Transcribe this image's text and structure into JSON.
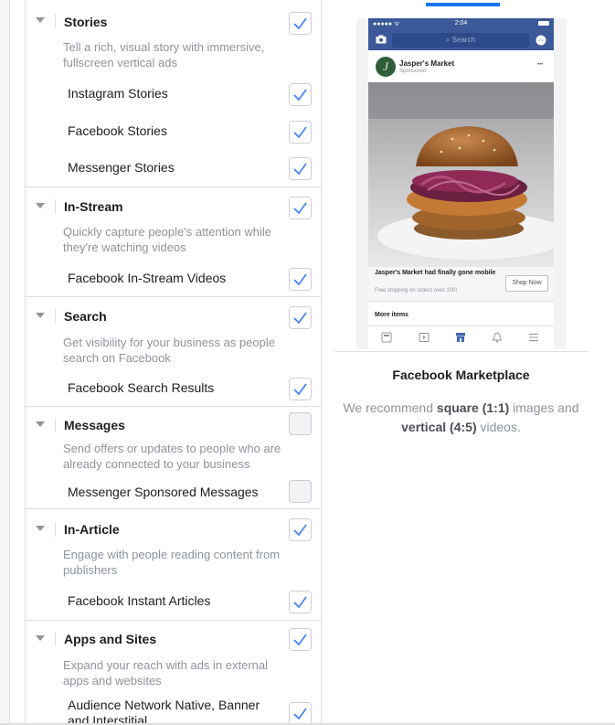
{
  "sections": [
    {
      "title": "Stories",
      "checked": true,
      "description": "Tell a rich, visual story with immersive, fullscreen vertical ads",
      "items": [
        {
          "label": "Instagram Stories",
          "checked": true
        },
        {
          "label": "Facebook Stories",
          "checked": true
        },
        {
          "label": "Messenger Stories",
          "checked": true
        }
      ]
    },
    {
      "title": "In-Stream",
      "checked": true,
      "description": "Quickly capture people's attention while they're watching videos",
      "items": [
        {
          "label": "Facebook In-Stream Videos",
          "checked": true
        }
      ]
    },
    {
      "title": "Search",
      "checked": true,
      "description": "Get visibility for your business as people search on Facebook",
      "items": [
        {
          "label": "Facebook Search Results",
          "checked": true
        }
      ]
    },
    {
      "title": "Messages",
      "checked": false,
      "description": "Send offers or updates to people who are already connected to your business",
      "items": [
        {
          "label": "Messenger Sponsored Messages",
          "checked": false
        }
      ]
    },
    {
      "title": "In-Article",
      "checked": true,
      "description": "Engage with people reading content from publishers",
      "items": [
        {
          "label": "Facebook Instant Articles",
          "checked": true
        }
      ]
    },
    {
      "title": "Apps and Sites",
      "checked": true,
      "description": "Expand your reach with ads in external apps and websites",
      "items": [
        {
          "label": "Audience Network Native, Banner and Interstitial",
          "checked": true
        }
      ]
    }
  ],
  "preview": {
    "status_time": "2:04",
    "status_carrier": "●●●●● ᯤ",
    "search_placeholder": "Search",
    "advertiser_name": "Jasper's Market",
    "advertiser_logo_letter": "J",
    "sponsored_label": "Sponsored",
    "more_menu": "•••",
    "ad_headline": "Jasper's Market had finally gone mobile",
    "ad_subtext": "Free shipping on orders over 100!",
    "cta_label": "Shop Now",
    "more_items_label": "More items",
    "placement_name": "Facebook Marketplace",
    "note_prefix": "We recommend ",
    "note_square": "square (1:1)",
    "note_middle": " images and ",
    "note_vertical": "vertical (4:5)",
    "note_suffix": " videos."
  },
  "colors": {
    "accent": "#1877f2",
    "check": "#4080ff",
    "facebook_header": "#3b5998",
    "muted_text": "#8d949e",
    "border": "#dddfe2"
  },
  "icons": {
    "section_toggle": "caret-down-icon",
    "checkbox_check": "checkmark-icon",
    "camera": "camera-icon",
    "messenger": "messenger-icon",
    "tabbar": [
      "news-feed-icon",
      "watch-icon",
      "marketplace-icon",
      "notifications-icon",
      "menu-icon"
    ]
  }
}
